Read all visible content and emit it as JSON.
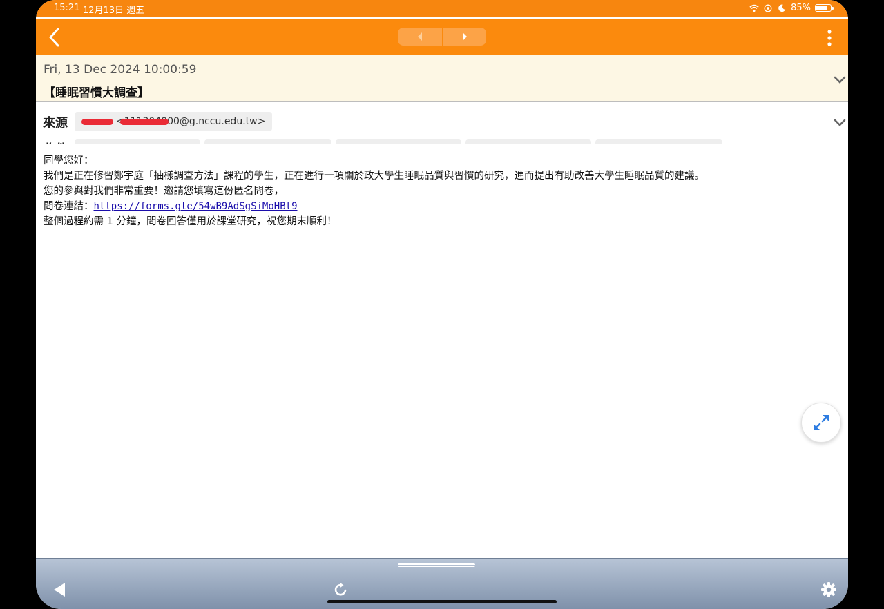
{
  "status_bar": {
    "time": "15:21",
    "date": "12月13日 週五",
    "battery": "85%",
    "battery_level": 0.85
  },
  "nav": {
    "back_icon": "chevron-left-icon",
    "prev_icon": "triangle-left-icon",
    "next_icon": "triangle-right-icon",
    "more_icon": "vertical-dots-icon"
  },
  "mail": {
    "date": "Fri, 13 Dec 2024 10:00:59",
    "subject": "【睡眠習慣大調查】",
    "from_label": "來源",
    "from_address": "<111304000@g.nccu.edu.tw>",
    "to_label": "收件"
  },
  "body": {
    "line1": "同學您好：",
    "line2": "我們是正在修習鄭宇庭「抽樣調查方法」課程的學生，正在進行一項關於政大學生睡眠品質與習慣的研究，進而提出有助改善大學生睡眠品質的建議。",
    "line3": "您的參與對我們非常重要！邀請您填寫這份匿名問卷，",
    "link_prefix": "問卷連結：",
    "link_text": "https://forms.gle/54wB9AdSgSiMoHBt9",
    "line5": "整個過程約需 1 分鐘，問卷回答僅用於課堂研究，祝您期末順利！"
  },
  "toolbar": {
    "back_icon": "triangle-left-icon",
    "reload_icon": "reload-icon",
    "settings_icon": "gear-icon"
  },
  "colors": {
    "accent": "#fb8a0d",
    "header_bg": "#fdf7e4",
    "link": "#1a0dab"
  }
}
